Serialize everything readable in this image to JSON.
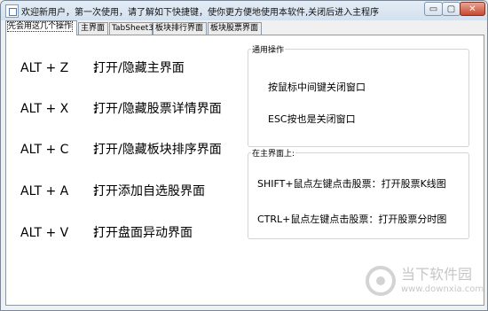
{
  "window": {
    "title": "欢迎新用户，第一次使用，请了解如下快捷键，使你更方便地使用本软件,关闭后进入主程序",
    "controls": {
      "minimize": "▭",
      "maximize": "▢",
      "close": "✕"
    }
  },
  "tabs": [
    {
      "label": "先会用这几个操作",
      "active": true
    },
    {
      "label": "主界面",
      "active": false
    },
    {
      "label": "TabSheet3",
      "active": false
    },
    {
      "label": "板块排行界面",
      "active": false
    },
    {
      "label": "板块股票界面",
      "active": false
    }
  ],
  "shortcuts": [
    {
      "key": "ALT + Z",
      "colon": "：",
      "desc": "打开/隐藏主界面"
    },
    {
      "key": "ALT + X",
      "colon": "：",
      "desc": "打开/隐藏股票详情界面"
    },
    {
      "key": "ALT + C",
      "colon": "：",
      "desc": "打开/隐藏板块排序界面"
    },
    {
      "key": "ALT + A",
      "colon": "：",
      "desc": "打开添加自选股界面"
    },
    {
      "key": "ALT + V",
      "colon": "：",
      "desc": "打开盘面异动界面"
    }
  ],
  "groups": {
    "general": {
      "title": "通用操作",
      "items": [
        "按鼠标中间键关闭窗口",
        "ESC按也是关闭窗口"
      ]
    },
    "main": {
      "title": "在主界面上:",
      "items": [
        "SHIFT+鼠点左键点击股票：打开股票K线图",
        "CTRL+鼠点左键点击股票：打开股票分时图"
      ]
    }
  },
  "watermark": {
    "name": "当下软件园",
    "url": "www.downxia.com"
  }
}
